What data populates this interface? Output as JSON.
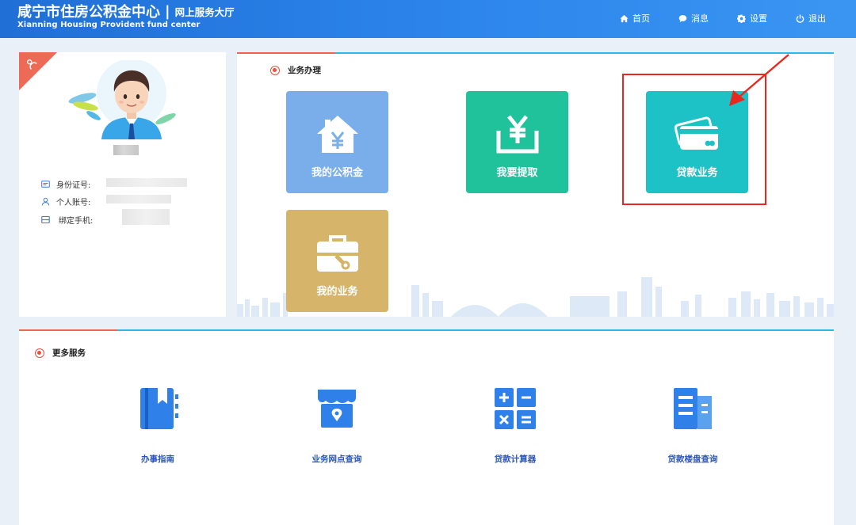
{
  "header": {
    "title": "咸宁市住房公积金中心",
    "separator": "|",
    "subtitle": "网上服务大厅",
    "title_en": "Xianning Housing Provident fund center",
    "nav": [
      {
        "label": "首页",
        "icon": "home-icon"
      },
      {
        "label": "消息",
        "icon": "message-icon"
      },
      {
        "label": "设置",
        "icon": "gear-icon"
      },
      {
        "label": "退出",
        "icon": "power-icon"
      }
    ]
  },
  "profile": {
    "id_label": "身份证号:",
    "account_label": "个人账号:",
    "phone_label": "绑定手机:"
  },
  "business": {
    "title": "业务办理",
    "tiles": [
      {
        "label": "我的公积金",
        "color": "#7aaeea",
        "icon": "house-yen-icon"
      },
      {
        "label": "我要提取",
        "color": "#1fc29b",
        "icon": "withdraw-yen-icon"
      },
      {
        "label": "贷款业务",
        "color": "#1cc2c6",
        "icon": "card-icon"
      },
      {
        "label": "我的业务",
        "color": "#d6b46a",
        "icon": "toolbox-icon"
      }
    ]
  },
  "more": {
    "title": "更多服务",
    "services": [
      {
        "label": "办事指南",
        "icon": "guide-book-icon"
      },
      {
        "label": "业务网点查询",
        "icon": "store-icon"
      },
      {
        "label": "贷款计算器",
        "icon": "calculator-icon"
      },
      {
        "label": "贷款楼盘查询",
        "icon": "building-icon"
      }
    ]
  },
  "colors": {
    "header": "#2d86ec",
    "accent_red": "#ee4f3c",
    "accent_blue": "#2eb8e6",
    "highlight": "#e8281f"
  }
}
